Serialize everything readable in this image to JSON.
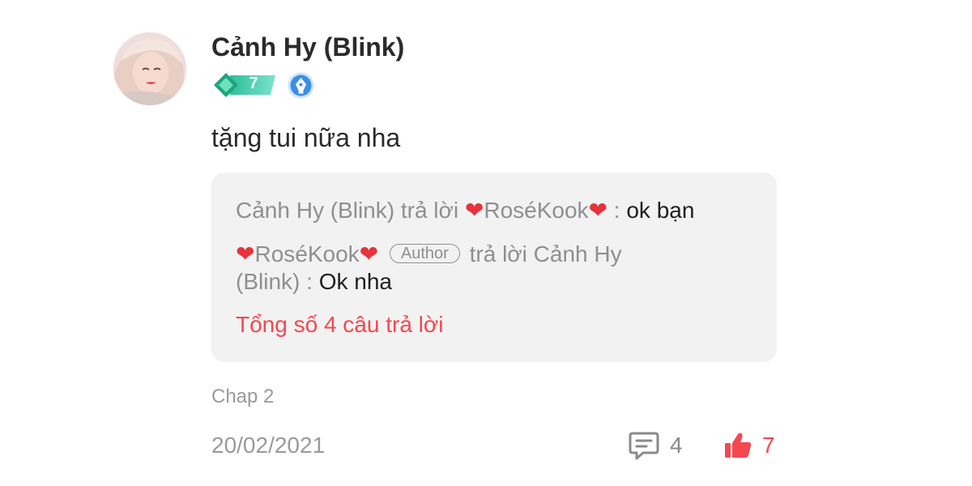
{
  "comment": {
    "username": "Cảnh Hy (Blink)",
    "level": "7",
    "text": "tặng tui nữa nha",
    "chapter": "Chap 2",
    "date": "20/02/2021",
    "reply_count": "4",
    "like_count": "7"
  },
  "replies": [
    {
      "author": "Cảnh Hy (Blink)",
      "verb": "trả lời",
      "target_heart_left": "❤",
      "target_name": "RoséKook",
      "target_heart_right": "❤",
      "separator": ":",
      "content": "ok bạn"
    },
    {
      "author_heart_left": "❤",
      "author": "RoséKook",
      "author_heart_right": "❤",
      "author_tag": "Author",
      "verb": "trả lời",
      "target_name_part1": "Cảnh Hy",
      "target_name_part2": "(Blink)",
      "separator": ":",
      "content": "Ok nha"
    }
  ],
  "total_replies_label": "Tổng số 4 câu trả lời",
  "colors": {
    "accent_red": "#f5474f",
    "level_badge": "#3ec9a7",
    "pen_badge": "#3a8ee6",
    "reply_bg": "#f2f2f2"
  },
  "icons": {
    "level": "diamond-level-icon",
    "pen": "pen-nib-icon",
    "comment": "chat-bubble-icon",
    "like": "thumbs-up-icon"
  }
}
